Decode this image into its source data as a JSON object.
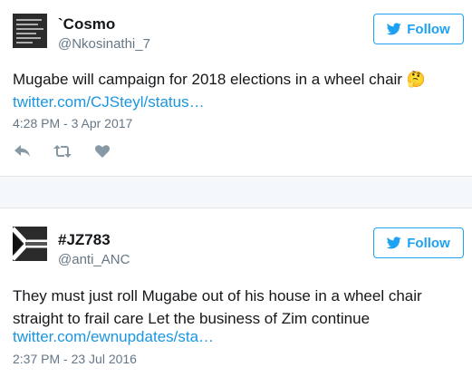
{
  "tweets": [
    {
      "display_name": "`Cosmo",
      "handle": "@Nkosinathi_7",
      "follow_label": "Follow",
      "text": "Mugabe will campaign for 2018 elections in a wheel chair",
      "emoji": "🤔",
      "link": "twitter.com/CJSteyl/status…",
      "timestamp": "4:28 PM - 3 Apr 2017",
      "actions": [
        "reply-icon",
        "retweet-icon",
        "like-icon"
      ]
    },
    {
      "display_name": "#JZ783",
      "handle": "@anti_ANC",
      "follow_label": "Follow",
      "text_line1": "They must just roll Mugabe out of his house in a wheel chair",
      "text_line2": "straight to frail care Let the business of Zim continue",
      "link": "twitter.com/ewnupdates/sta…",
      "timestamp": "2:37 PM - 23 Jul 2016"
    }
  ],
  "colors": {
    "twitter_blue": "#1da1f2",
    "link_blue": "#1b95e0",
    "secondary_text": "#657786",
    "separator_bg": "#f5f8fa"
  }
}
